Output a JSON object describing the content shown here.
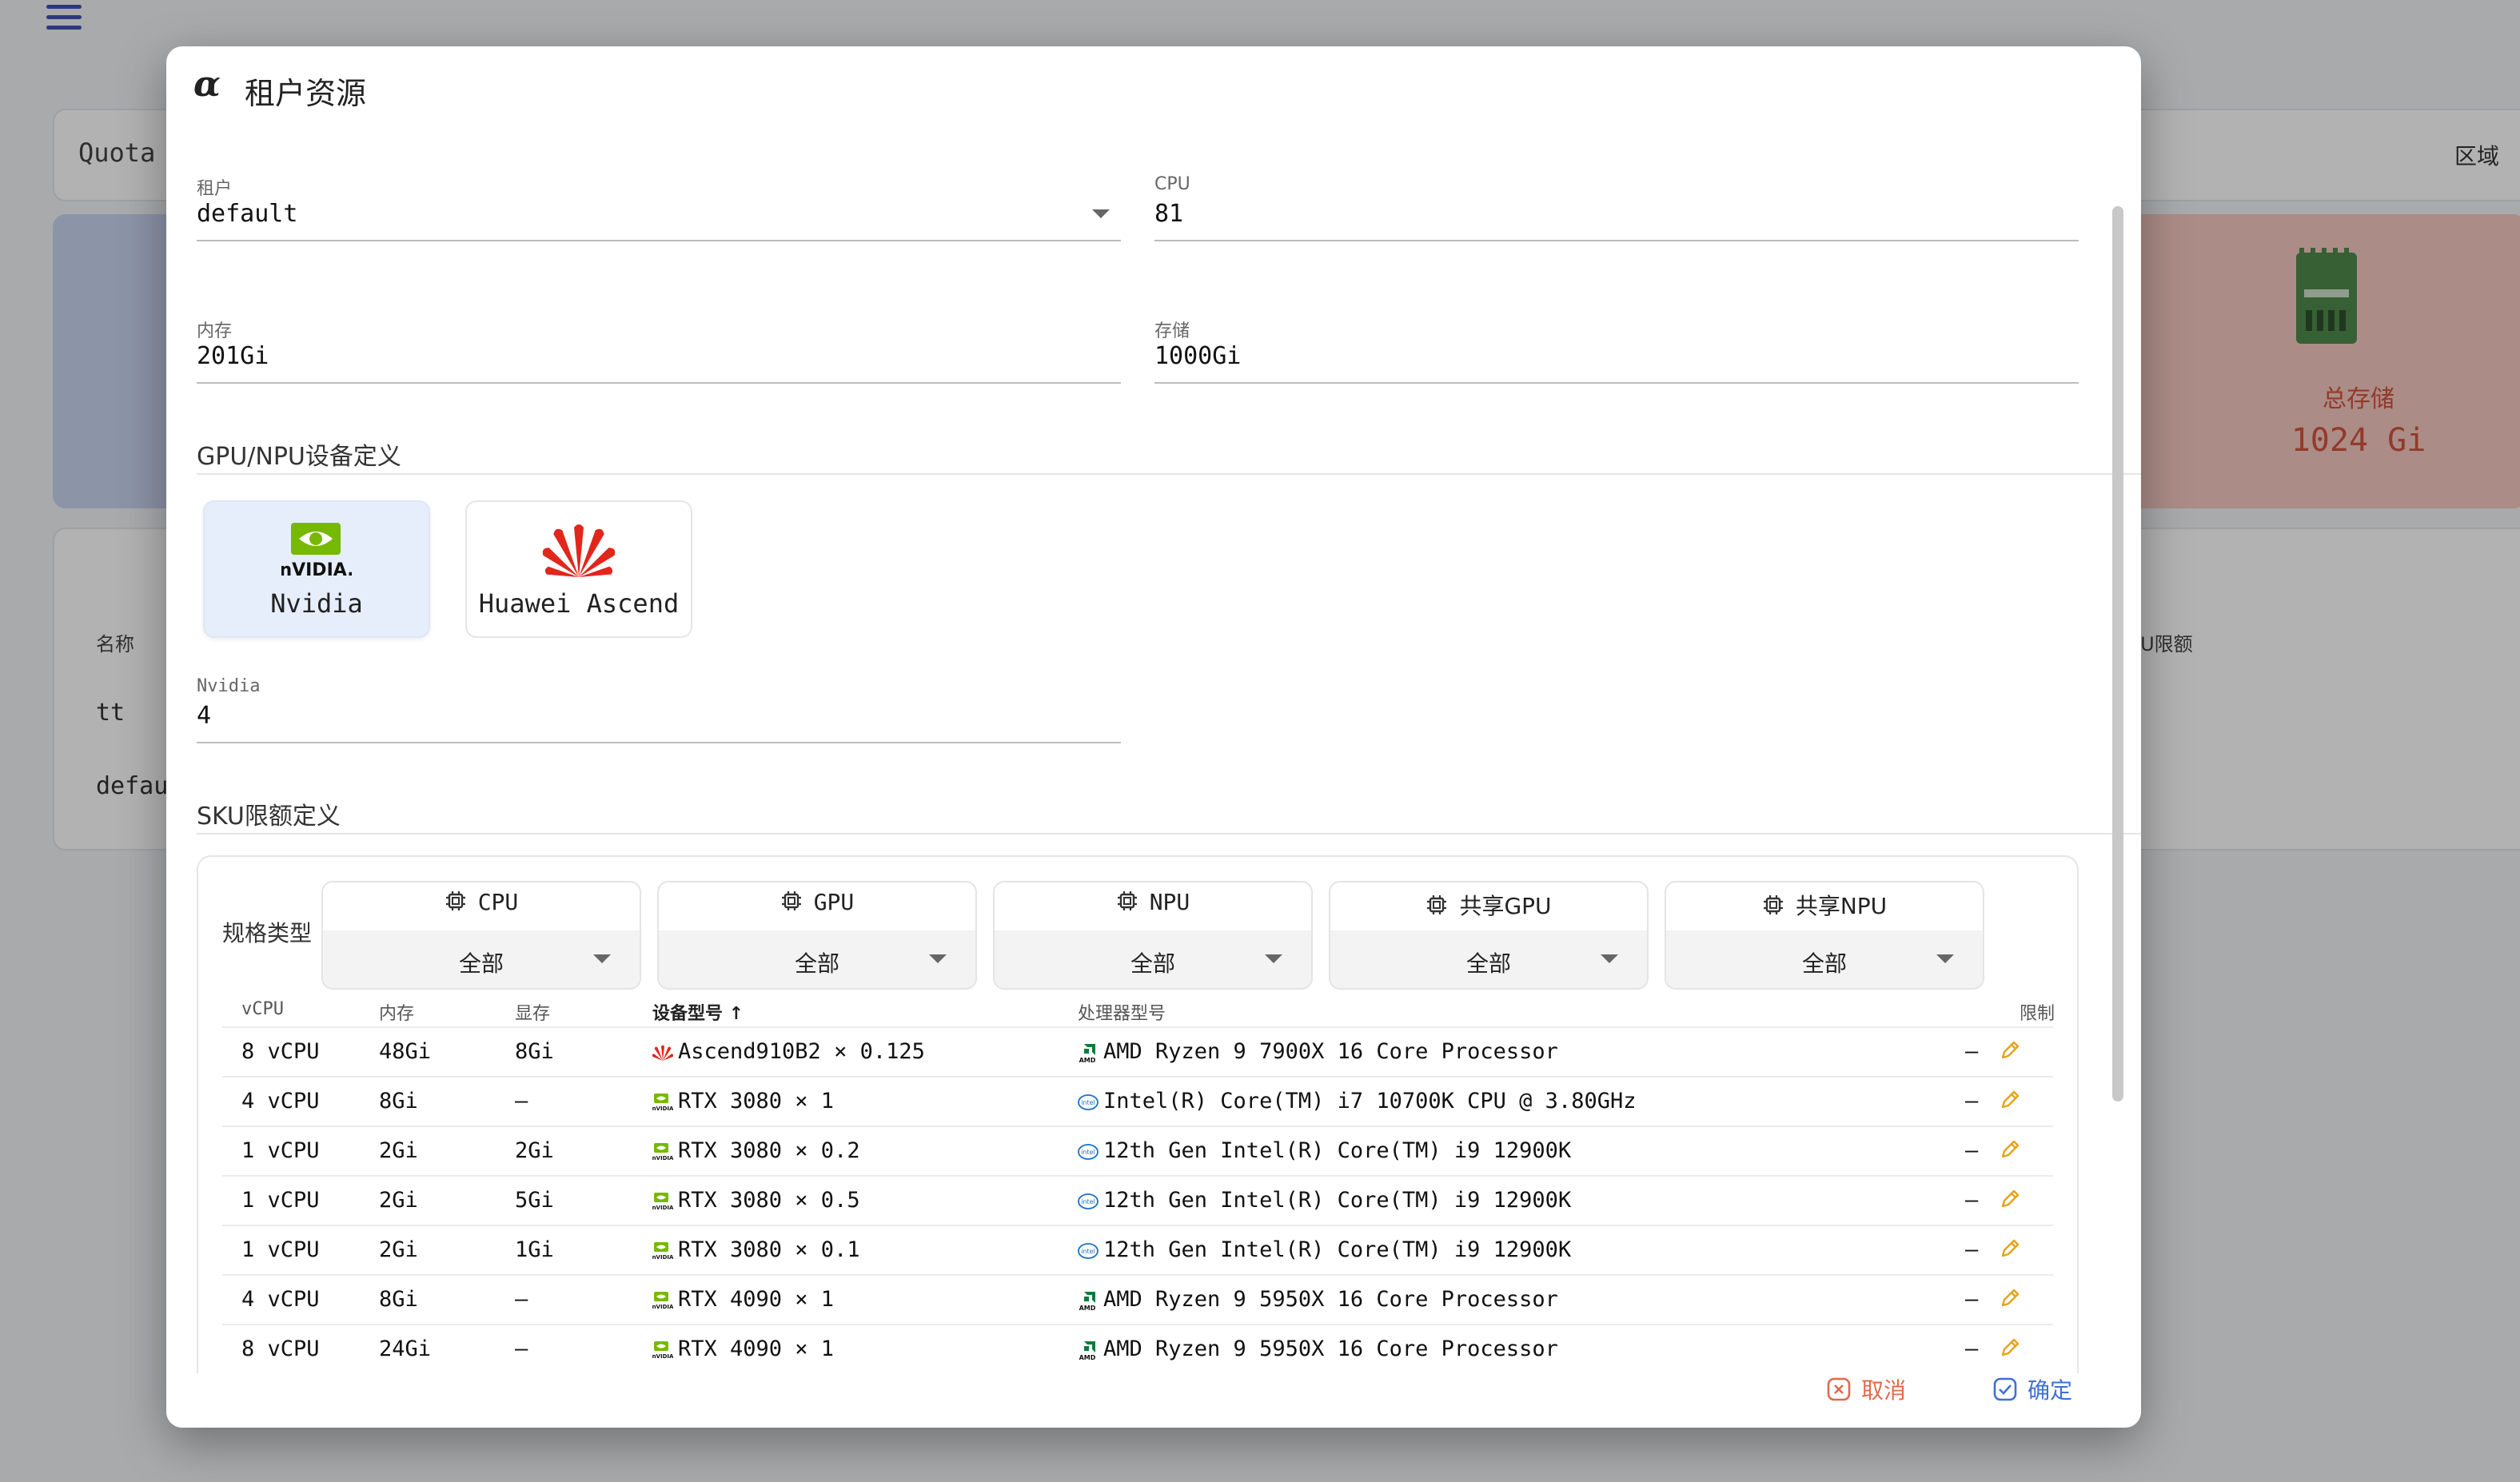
{
  "background": {
    "tab_label": "Quota",
    "region_label": "区域",
    "storage_stat": {
      "title": "总存储",
      "value": "1024 Gi"
    },
    "table": {
      "header_name": "名称",
      "header_sku": "KU限额",
      "rows": [
        "tt",
        "defau"
      ]
    }
  },
  "dialog": {
    "logo": "α",
    "title": "租户资源",
    "fields": {
      "tenant": {
        "label": "租户",
        "value": "default"
      },
      "cpu": {
        "label": "CPU",
        "value": "81"
      },
      "memory": {
        "label": "内存",
        "value": "201Gi"
      },
      "storage": {
        "label": "存储",
        "value": "1000Gi"
      }
    },
    "gpu_section_title": "GPU/NPU设备定义",
    "vendors": [
      {
        "name": "Nvidia",
        "selected": true
      },
      {
        "name": "Huawei Ascend",
        "selected": false
      }
    ],
    "nvidia_field": {
      "label": "Nvidia",
      "value": "4"
    },
    "sku_section_title": "SKU限额定义",
    "spec_type_label": "规格类型",
    "filters": [
      {
        "name": "CPU",
        "value": "全部"
      },
      {
        "name": "GPU",
        "value": "全部"
      },
      {
        "name": "NPU",
        "value": "全部"
      },
      {
        "name": "共享GPU",
        "value": "全部"
      },
      {
        "name": "共享NPU",
        "value": "全部"
      }
    ],
    "table": {
      "headers": {
        "vcpu": "vCPU",
        "memory": "内存",
        "vram": "显存",
        "device": "设备型号 ↑",
        "processor": "处理器型号",
        "limit": "限制"
      },
      "rows": [
        {
          "vcpu": "8 vCPU",
          "memory": "48Gi",
          "vram": "8Gi",
          "device_vendor": "huawei",
          "device": "Ascend910B2 × 0.125",
          "cpu_vendor": "amd",
          "processor": "AMD Ryzen 9 7900X 16 Core Processor",
          "limit": "–"
        },
        {
          "vcpu": "4 vCPU",
          "memory": "8Gi",
          "vram": "–",
          "device_vendor": "nvidia",
          "device": "RTX 3080 × 1",
          "cpu_vendor": "intel",
          "processor": "Intel(R) Core(TM) i7 10700K CPU @ 3.80GHz",
          "limit": "–"
        },
        {
          "vcpu": "1 vCPU",
          "memory": "2Gi",
          "vram": "2Gi",
          "device_vendor": "nvidia",
          "device": "RTX 3080 × 0.2",
          "cpu_vendor": "intel",
          "processor": "12th Gen Intel(R) Core(TM) i9 12900K",
          "limit": "–"
        },
        {
          "vcpu": "1 vCPU",
          "memory": "2Gi",
          "vram": "5Gi",
          "device_vendor": "nvidia",
          "device": "RTX 3080 × 0.5",
          "cpu_vendor": "intel",
          "processor": "12th Gen Intel(R) Core(TM) i9 12900K",
          "limit": "–"
        },
        {
          "vcpu": "1 vCPU",
          "memory": "2Gi",
          "vram": "1Gi",
          "device_vendor": "nvidia",
          "device": "RTX 3080 × 0.1",
          "cpu_vendor": "intel",
          "processor": "12th Gen Intel(R) Core(TM) i9 12900K",
          "limit": "–"
        },
        {
          "vcpu": "4 vCPU",
          "memory": "8Gi",
          "vram": "–",
          "device_vendor": "nvidia",
          "device": "RTX 4090 × 1",
          "cpu_vendor": "amd",
          "processor": "AMD Ryzen 9 5950X 16 Core Processor",
          "limit": "–"
        },
        {
          "vcpu": "8 vCPU",
          "memory": "24Gi",
          "vram": "–",
          "device_vendor": "nvidia",
          "device": "RTX 4090 × 1",
          "cpu_vendor": "amd",
          "processor": "AMD Ryzen 9 5950X 16 Core Processor",
          "limit": "–"
        }
      ]
    },
    "buttons": {
      "cancel": "取消",
      "confirm": "确定"
    }
  },
  "colors": {
    "accent": "#3f51b5",
    "cancel": "#e06a4c",
    "confirm": "#3f6fd8",
    "edit": "#e6a21a",
    "nvidia": "#76b900",
    "huawei": "#e1261c"
  }
}
